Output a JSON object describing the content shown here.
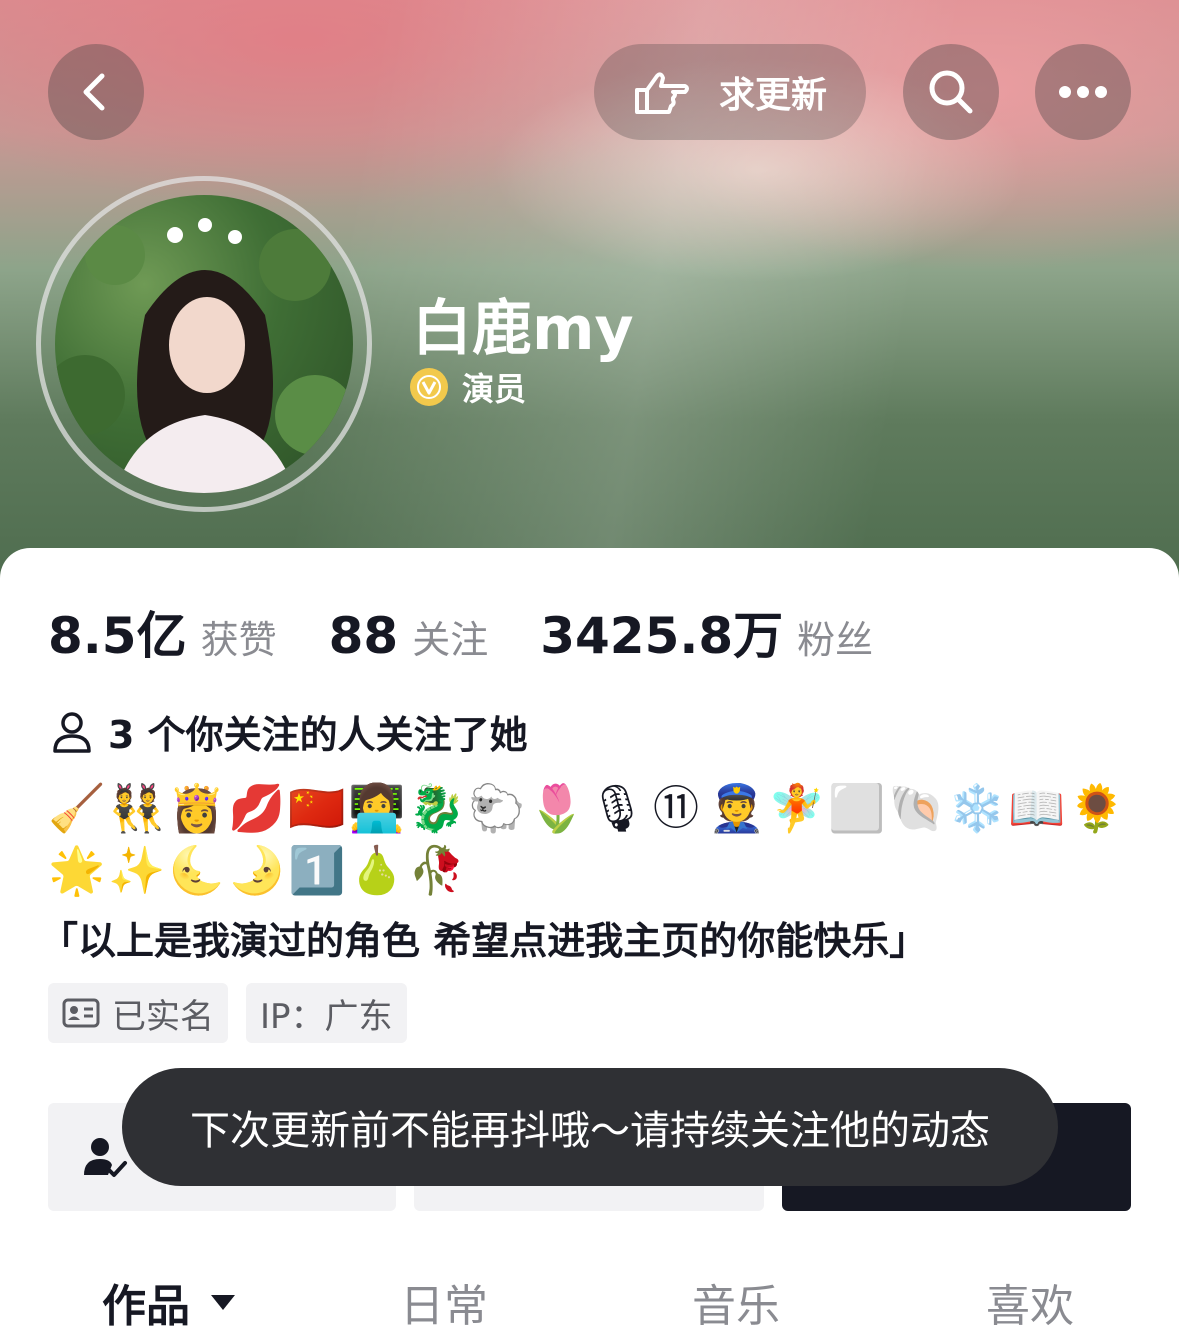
{
  "header": {
    "back_icon": "chevron-left-icon",
    "request_update_label": "求更新",
    "request_update_icon": "pointing-hand-icon",
    "search_icon": "search-icon",
    "more_icon": "more-horizontal-icon"
  },
  "profile": {
    "name": "白鹿my",
    "verified_label": "演员",
    "verified_icon": "verified-v-icon",
    "verified_color": "#f2c94c"
  },
  "stats": [
    {
      "value": "8.5亿",
      "label": "获赞"
    },
    {
      "value": "88",
      "label": "关注"
    },
    {
      "value": "3425.8万",
      "label": "粉丝"
    }
  ],
  "mutual_follow": "3 个你关注的人关注了她",
  "emoji_rows": [
    [
      "🧹",
      "👯",
      "👸",
      "💋",
      "🇨🇳",
      "👩‍💻",
      "🐉",
      "🐑",
      "🌷",
      "🎙",
      "⑪",
      "👮",
      "🧚",
      "⬜",
      "🐚",
      "❄️",
      "📖",
      "🌻"
    ],
    [
      "🌟",
      "✨",
      "🌜",
      "🌛",
      "1️⃣",
      "🍐",
      "🥀"
    ]
  ],
  "bio": "「以上是我演过的角色 希望点进我主页的你能快乐」",
  "tags": [
    {
      "icon": "id-card-icon",
      "label": "已实名"
    },
    {
      "label": "IP：广东"
    }
  ],
  "toast": "下次更新前不能再抖哦～请持续关注他的动态",
  "tabs": [
    {
      "label": "作品",
      "active": true
    },
    {
      "label": "日常"
    },
    {
      "label": "音乐"
    },
    {
      "label": "喜欢"
    }
  ],
  "colors": {
    "primary_text": "#161823",
    "secondary_text": "#8a8b91",
    "dark_button": "#161823",
    "toast_bg": "#2f3034"
  }
}
